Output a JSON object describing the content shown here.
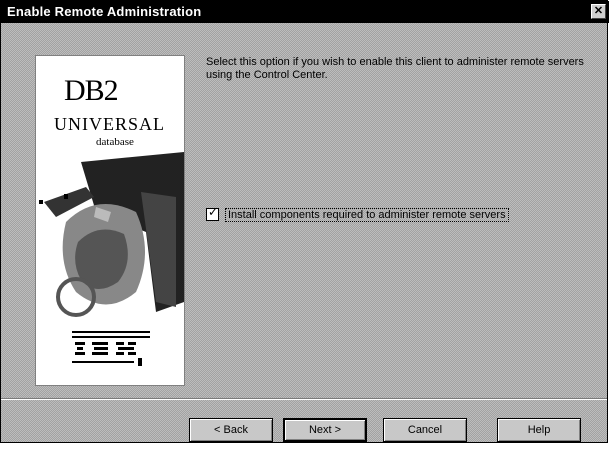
{
  "window": {
    "title": "Enable Remote Administration",
    "close_glyph": "✕"
  },
  "splash": {
    "logo_db2": "DB2",
    "logo_universal": "UNIVERSAL",
    "logo_database": "database",
    "vendor": "IBM"
  },
  "content": {
    "description": "Select this option if you wish to enable this client to administer remote servers using the Control Center.",
    "checkbox": {
      "label": "Install components required to administer remote servers",
      "checked": true,
      "tick_glyph": "✓"
    }
  },
  "buttons": {
    "back": "< Back",
    "next": "Next >",
    "cancel": "Cancel",
    "help": "Help"
  },
  "colors": {
    "titlebar": "#000000",
    "dialog_face": "#bdbdbd"
  }
}
